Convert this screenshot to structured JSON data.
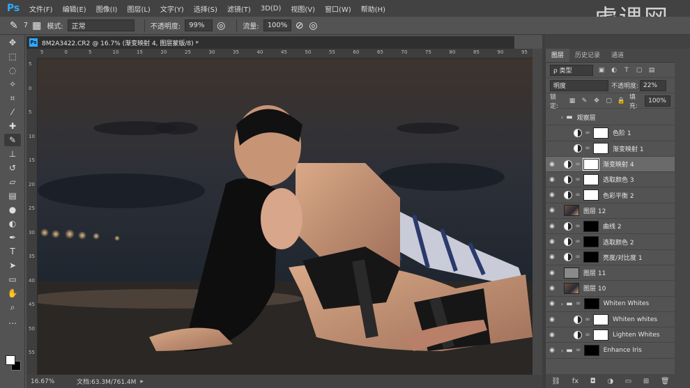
{
  "app": {
    "logo": "Ps"
  },
  "menu": [
    "文件(F)",
    "编辑(E)",
    "图像(I)",
    "图层(L)",
    "文字(Y)",
    "选择(S)",
    "滤镜(T)",
    "3D(D)",
    "视图(V)",
    "窗口(W)",
    "帮助(H)"
  ],
  "watermark": "虎课网",
  "options": {
    "brush_size": "7",
    "mode_label": "模式:",
    "mode_value": "正常",
    "opacity_label": "不透明度:",
    "opacity_value": "99%",
    "flow_label": "流量:",
    "flow_value": "100%"
  },
  "document": {
    "tab_title": "8M2A3422.CR2 @ 16.7% (渐变映射 4, 图层蒙版/8) *",
    "ruler_top": [
      "5",
      "0",
      "5",
      "10",
      "15",
      "20",
      "25",
      "30",
      "35",
      "40",
      "45",
      "50",
      "55",
      "60",
      "65",
      "70",
      "75",
      "80",
      "85",
      "90",
      "95"
    ],
    "ruler_left": [
      "5",
      "0",
      "5",
      "10",
      "15",
      "20",
      "25",
      "30",
      "35",
      "40",
      "45",
      "50",
      "55"
    ],
    "zoom": "16.67%",
    "doc_info": "文档:63.3M/761.4M"
  },
  "panel": {
    "tabs": [
      "图层",
      "历史记录",
      "通道"
    ],
    "filter_label": "ρ 类型",
    "blend_mode": "明度",
    "opacity_label": "不透明度:",
    "opacity_value": "22%",
    "lock_label": "锁定:",
    "fill_label": "填充:",
    "fill_value": "100%",
    "layers": [
      {
        "name": "观察层",
        "kind": "group",
        "visible": false,
        "indent": 0
      },
      {
        "name": "色阶 1",
        "kind": "adj",
        "thumb": "white",
        "visible": false,
        "indent": 1
      },
      {
        "name": "渐变映射 1",
        "kind": "adj",
        "thumb": "white",
        "visible": false,
        "indent": 1
      },
      {
        "name": "渐变映射 4",
        "kind": "adj",
        "thumb": "white",
        "visible": true,
        "selected": true,
        "indent": 0
      },
      {
        "name": "选取颜色 3",
        "kind": "adj",
        "thumb": "white",
        "visible": true,
        "indent": 0
      },
      {
        "name": "色彩平衡 2",
        "kind": "adj",
        "thumb": "white",
        "visible": true,
        "indent": 0
      },
      {
        "name": "图层 12",
        "kind": "pixel",
        "thumb": "photo",
        "visible": true,
        "indent": 0
      },
      {
        "name": "曲线 2",
        "kind": "adj",
        "thumb": "black",
        "visible": true,
        "indent": 0
      },
      {
        "name": "选取颜色 2",
        "kind": "adj",
        "thumb": "black",
        "visible": true,
        "indent": 0
      },
      {
        "name": "亮度/对比度 1",
        "kind": "adj",
        "thumb": "black",
        "visible": true,
        "indent": 0
      },
      {
        "name": "图层 11",
        "kind": "pixel",
        "thumb": "gray",
        "visible": true,
        "indent": 0
      },
      {
        "name": "图层 10",
        "kind": "pixel",
        "thumb": "photo",
        "visible": true,
        "indent": 0
      },
      {
        "name": "Whiten Whites",
        "kind": "group",
        "thumb": "black",
        "visible": true,
        "indent": 0
      },
      {
        "name": "Whiten whites",
        "kind": "adj",
        "thumb": "white",
        "visible": true,
        "indent": 1
      },
      {
        "name": "Lighten Whites",
        "kind": "adj",
        "thumb": "white",
        "visible": true,
        "indent": 1
      },
      {
        "name": "Enhance Iris",
        "kind": "group",
        "thumb": "black",
        "visible": true,
        "indent": 0
      }
    ]
  }
}
